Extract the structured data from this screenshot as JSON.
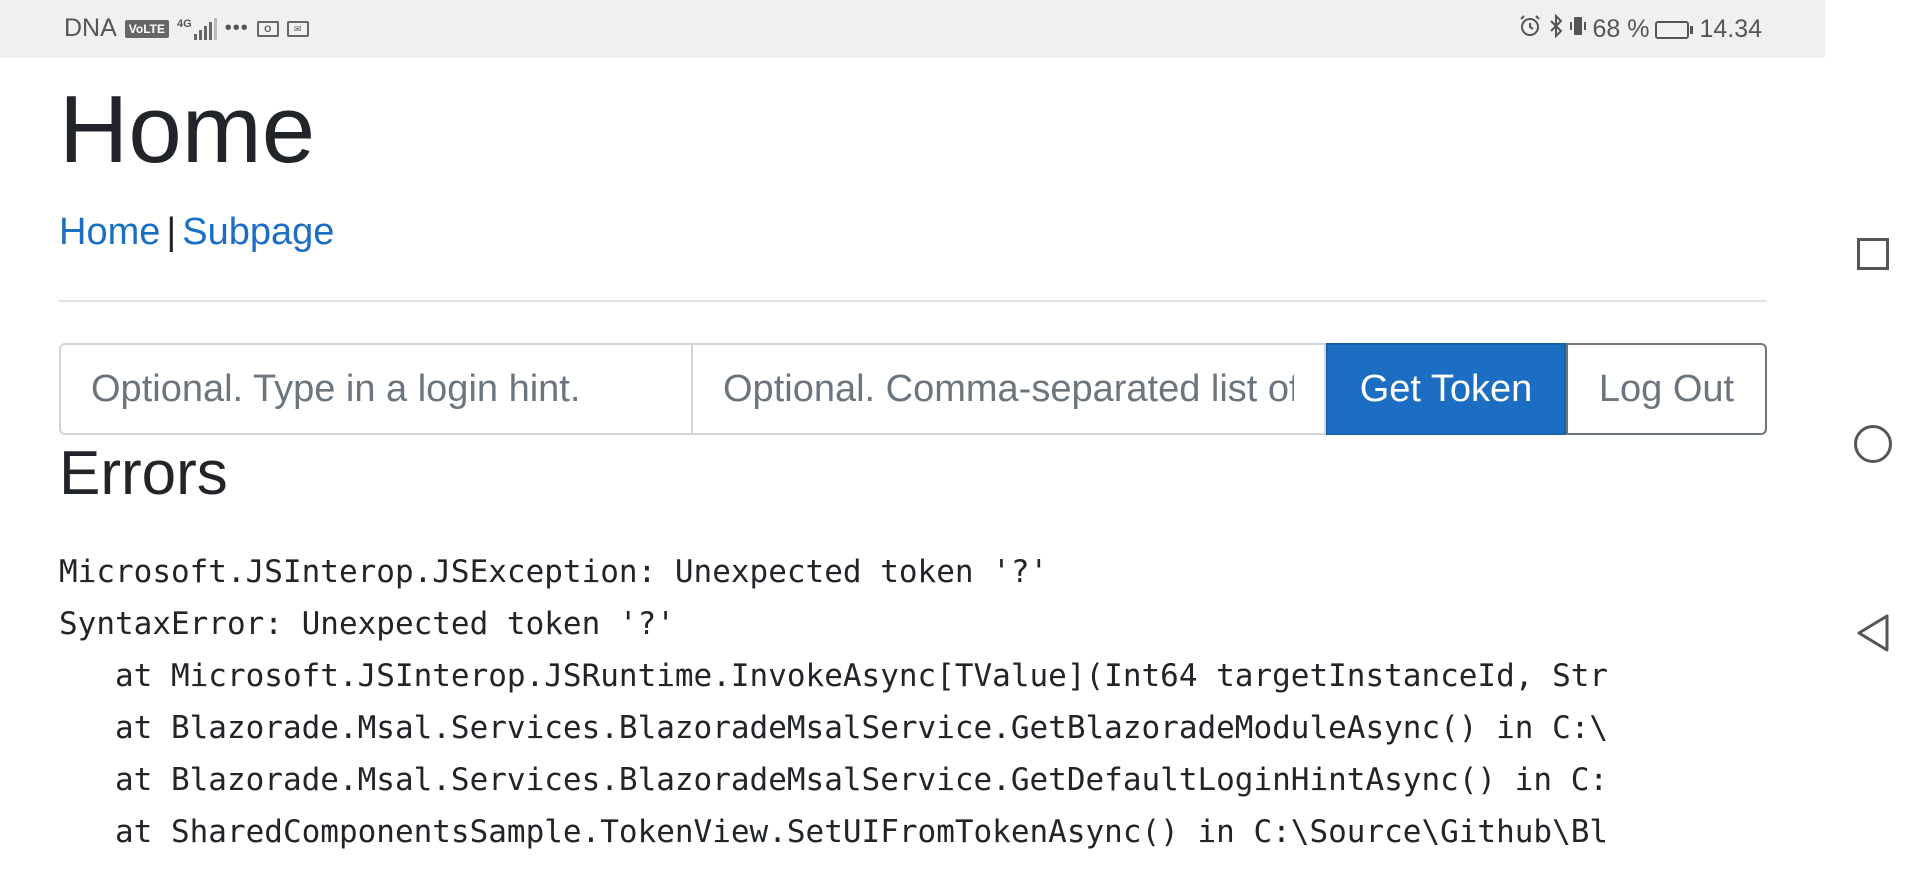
{
  "status_bar": {
    "carrier": "DNA",
    "volte": "VoLTE",
    "network": "4G",
    "battery_percent_label": "68 %",
    "battery_level": 0.68,
    "time": "14.34",
    "icons": [
      "volte-icon",
      "signal-icon",
      "more-dots-icon",
      "outlook-icon",
      "mail-icon",
      "alarm-icon",
      "bluetooth-icon",
      "vibrate-icon",
      "battery-icon"
    ]
  },
  "page": {
    "title": "Home",
    "nav": {
      "home": "Home",
      "separator": "|",
      "subpage": "Subpage"
    },
    "login_hint_placeholder": "Optional. Type in a login hint.",
    "scopes_placeholder": "Optional. Comma-separated list of scopes.",
    "get_token_label": "Get Token",
    "log_out_label": "Log Out",
    "errors_heading": "Errors",
    "error_lines": [
      "Microsoft.JSInterop.JSException: Unexpected token '?'",
      "SyntaxError: Unexpected token '?'",
      "   at Microsoft.JSInterop.JSRuntime.InvokeAsync[TValue](Int64 targetInstanceId, Str",
      "   at Blazorade.Msal.Services.BlazoradeMsalService.GetBlazoradeModuleAsync() in C:\\",
      "   at Blazorade.Msal.Services.BlazoradeMsalService.GetDefaultLoginHintAsync() in C:",
      "   at SharedComponentsSample.TokenView.SetUIFromTokenAsync() in C:\\Source\\Github\\Bl"
    ]
  },
  "nav_bar": {
    "buttons": [
      "recent-apps-icon",
      "home-circle-icon",
      "back-triangle-icon"
    ]
  },
  "colors": {
    "primary": "#1b6ec2",
    "link": "#1b6ec2",
    "text": "#212529",
    "status_bar_bg": "#f0f0f0"
  }
}
